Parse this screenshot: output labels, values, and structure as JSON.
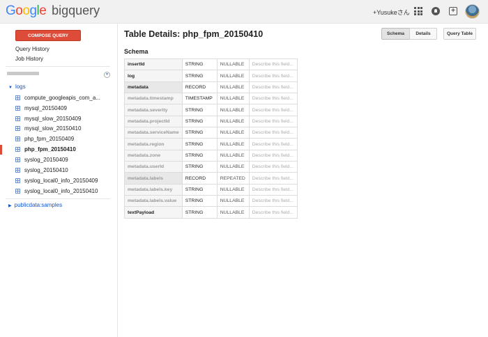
{
  "header": {
    "logo_google": [
      "G",
      "o",
      "o",
      "g",
      "l",
      "e"
    ],
    "product": "bigquery",
    "user": "+Yusukeさん"
  },
  "sidebar": {
    "compose_label": "COMPOSE QUERY",
    "query_history": "Query History",
    "job_history": "Job History",
    "dataset": "logs",
    "tables": [
      "compute_googleapis_com_a...",
      "mysql_20150409",
      "mysql_slow_20150409",
      "mysql_slow_20150410",
      "php_fpm_20150409",
      "php_fpm_20150410",
      "syslog_20150409",
      "syslog_20150410",
      "syslog_local0_info_20150409",
      "syslog_local0_info_20150410"
    ],
    "selected_table": "php_fpm_20150410",
    "public_dataset": "publicdata:samples"
  },
  "main": {
    "title": "Table Details: php_fpm_20150410",
    "tab_schema": "Schema",
    "tab_details": "Details",
    "query_table": "Query Table",
    "section": "Schema",
    "schema": [
      {
        "name": "insertId",
        "type": "STRING",
        "mode": "NULLABLE",
        "desc": "Describe this field..."
      },
      {
        "name": "log",
        "type": "STRING",
        "mode": "NULLABLE",
        "desc": "Describe this field..."
      },
      {
        "name": "metadata",
        "type": "RECORD",
        "mode": "NULLABLE",
        "desc": "Describe this field..."
      },
      {
        "name": "metadata.timestamp",
        "type": "TIMESTAMP",
        "mode": "NULLABLE",
        "desc": "Describe this field..."
      },
      {
        "name": "metadata.severity",
        "type": "STRING",
        "mode": "NULLABLE",
        "desc": "Describe this field..."
      },
      {
        "name": "metadata.projectId",
        "type": "STRING",
        "mode": "NULLABLE",
        "desc": "Describe this field..."
      },
      {
        "name": "metadata.serviceName",
        "type": "STRING",
        "mode": "NULLABLE",
        "desc": "Describe this field..."
      },
      {
        "name": "metadata.region",
        "type": "STRING",
        "mode": "NULLABLE",
        "desc": "Describe this field..."
      },
      {
        "name": "metadata.zone",
        "type": "STRING",
        "mode": "NULLABLE",
        "desc": "Describe this field..."
      },
      {
        "name": "metadata.userId",
        "type": "STRING",
        "mode": "NULLABLE",
        "desc": "Describe this field..."
      },
      {
        "name": "metadata.labels",
        "type": "RECORD",
        "mode": "REPEATED",
        "desc": "Describe this field..."
      },
      {
        "name": "metadata.labels.key",
        "type": "STRING",
        "mode": "NULLABLE",
        "desc": "Describe this field..."
      },
      {
        "name": "metadata.labels.value",
        "type": "STRING",
        "mode": "NULLABLE",
        "desc": "Describe this field..."
      },
      {
        "name": "textPayload",
        "type": "STRING",
        "mode": "NULLABLE",
        "desc": "Describe this field..."
      }
    ]
  }
}
